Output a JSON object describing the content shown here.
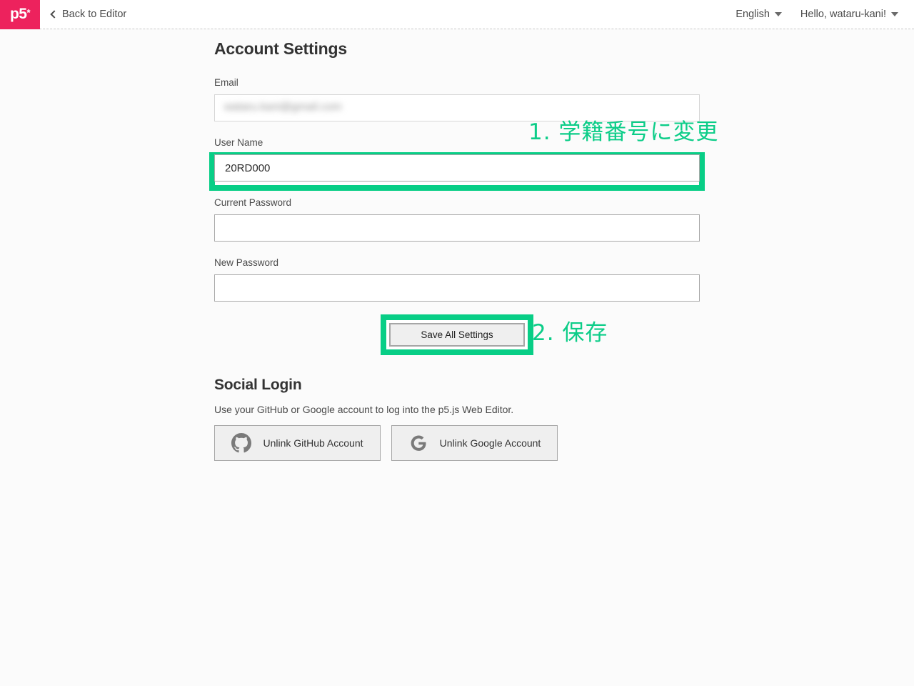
{
  "header": {
    "logo_text": "p5",
    "logo_sup": "*",
    "back_label": "Back to Editor",
    "language_label": "English",
    "greeting_label": "Hello, wataru-kani!",
    "brand_color": "#ed225d"
  },
  "page": {
    "title": "Account Settings"
  },
  "form": {
    "email": {
      "label": "Email",
      "value": "wataru.kani@gmail.com",
      "redacted": true
    },
    "username": {
      "label": "User Name",
      "value": "20RD000",
      "highlighted": true
    },
    "current_password": {
      "label": "Current Password",
      "value": ""
    },
    "new_password": {
      "label": "New Password",
      "value": ""
    },
    "save_label": "Save All Settings"
  },
  "annotations": {
    "color": "#0ccd88",
    "step1": "1. 学籍番号に変更",
    "step2": "2. 保存"
  },
  "social": {
    "title": "Social Login",
    "description": "Use your GitHub or Google account to log into the p5.js Web Editor.",
    "github_label": "Unlink GitHub Account",
    "google_label": "Unlink Google Account"
  }
}
